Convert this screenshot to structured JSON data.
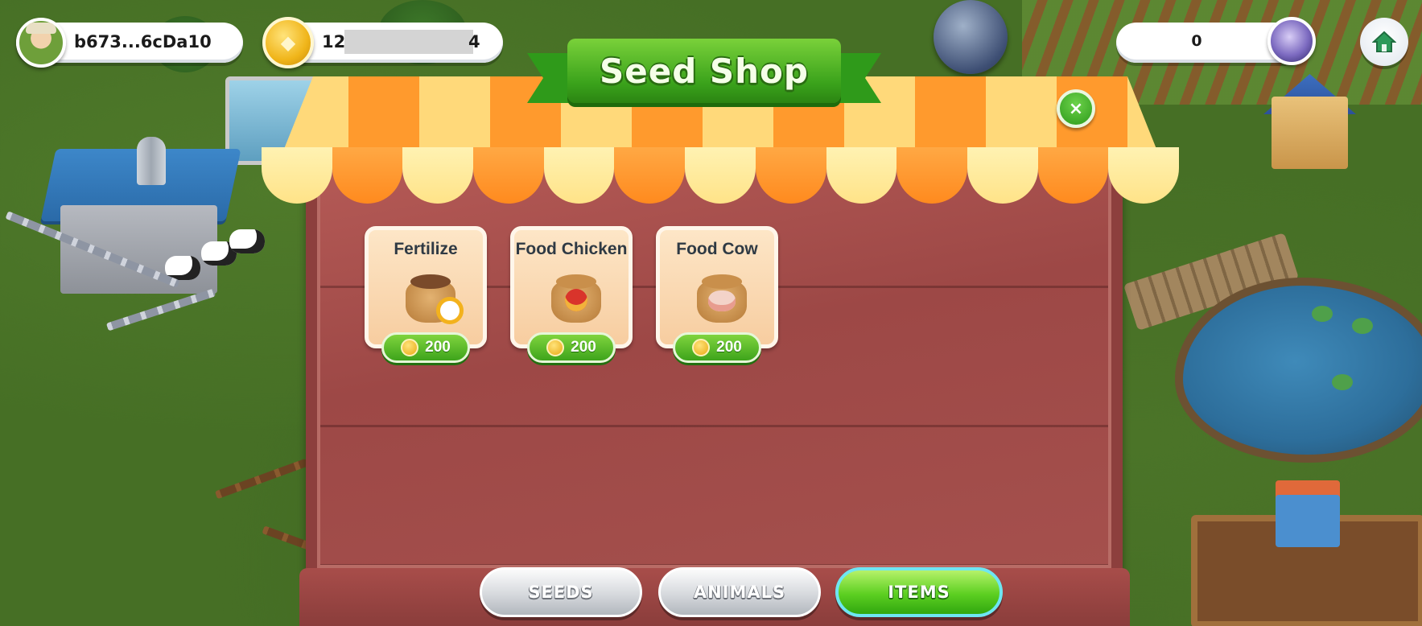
{
  "hud": {
    "player_name": "b673...6cDa10",
    "coin_balance_prefix": "12",
    "coin_balance_suffix": "4",
    "gem_balance": "0"
  },
  "shop": {
    "title": "Seed Shop",
    "close_symbol": "×",
    "items": [
      {
        "name": "Fertilize",
        "price": "200",
        "icon": "fertilizer-sack-icon"
      },
      {
        "name": "Food Chicken",
        "price": "200",
        "icon": "chicken-food-sack-icon"
      },
      {
        "name": "Food Cow",
        "price": "200",
        "icon": "cow-food-sack-icon"
      }
    ],
    "tabs": [
      {
        "label": "SEEDS",
        "active": false
      },
      {
        "label": "ANIMALS",
        "active": false
      },
      {
        "label": "ITEMS",
        "active": true
      }
    ]
  },
  "colors": {
    "board": "#a5504d",
    "accent_green": "#3ea41b",
    "awning_orange": "#ff9a2d",
    "awning_cream": "#ffe388"
  }
}
